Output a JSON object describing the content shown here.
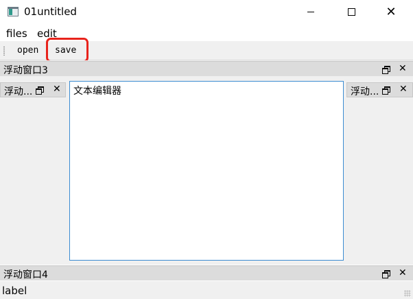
{
  "window": {
    "title": "01untitled",
    "icons": {
      "app": "app-window-icon",
      "minimize": "minimize-icon",
      "maximize": "maximize-icon",
      "close": "close-icon"
    },
    "close_glyph": "✕"
  },
  "menubar": {
    "items": [
      {
        "label": "files"
      },
      {
        "label": "edit"
      }
    ]
  },
  "toolbar": {
    "actions": [
      {
        "label": "open"
      },
      {
        "label": "save",
        "highlighted": true
      }
    ],
    "highlight_color": "#e8231c"
  },
  "docks": {
    "top": {
      "title": "浮动窗口3"
    },
    "left": {
      "title": "浮动..."
    },
    "right": {
      "title": "浮动..."
    },
    "bottom": {
      "title": "浮动窗口4"
    },
    "float_icon": "float-restore-icon",
    "close_glyph": "✕"
  },
  "editor": {
    "text": "文本编辑器",
    "border_color": "#3b8bd1"
  },
  "statusbar": {
    "label": "label"
  }
}
